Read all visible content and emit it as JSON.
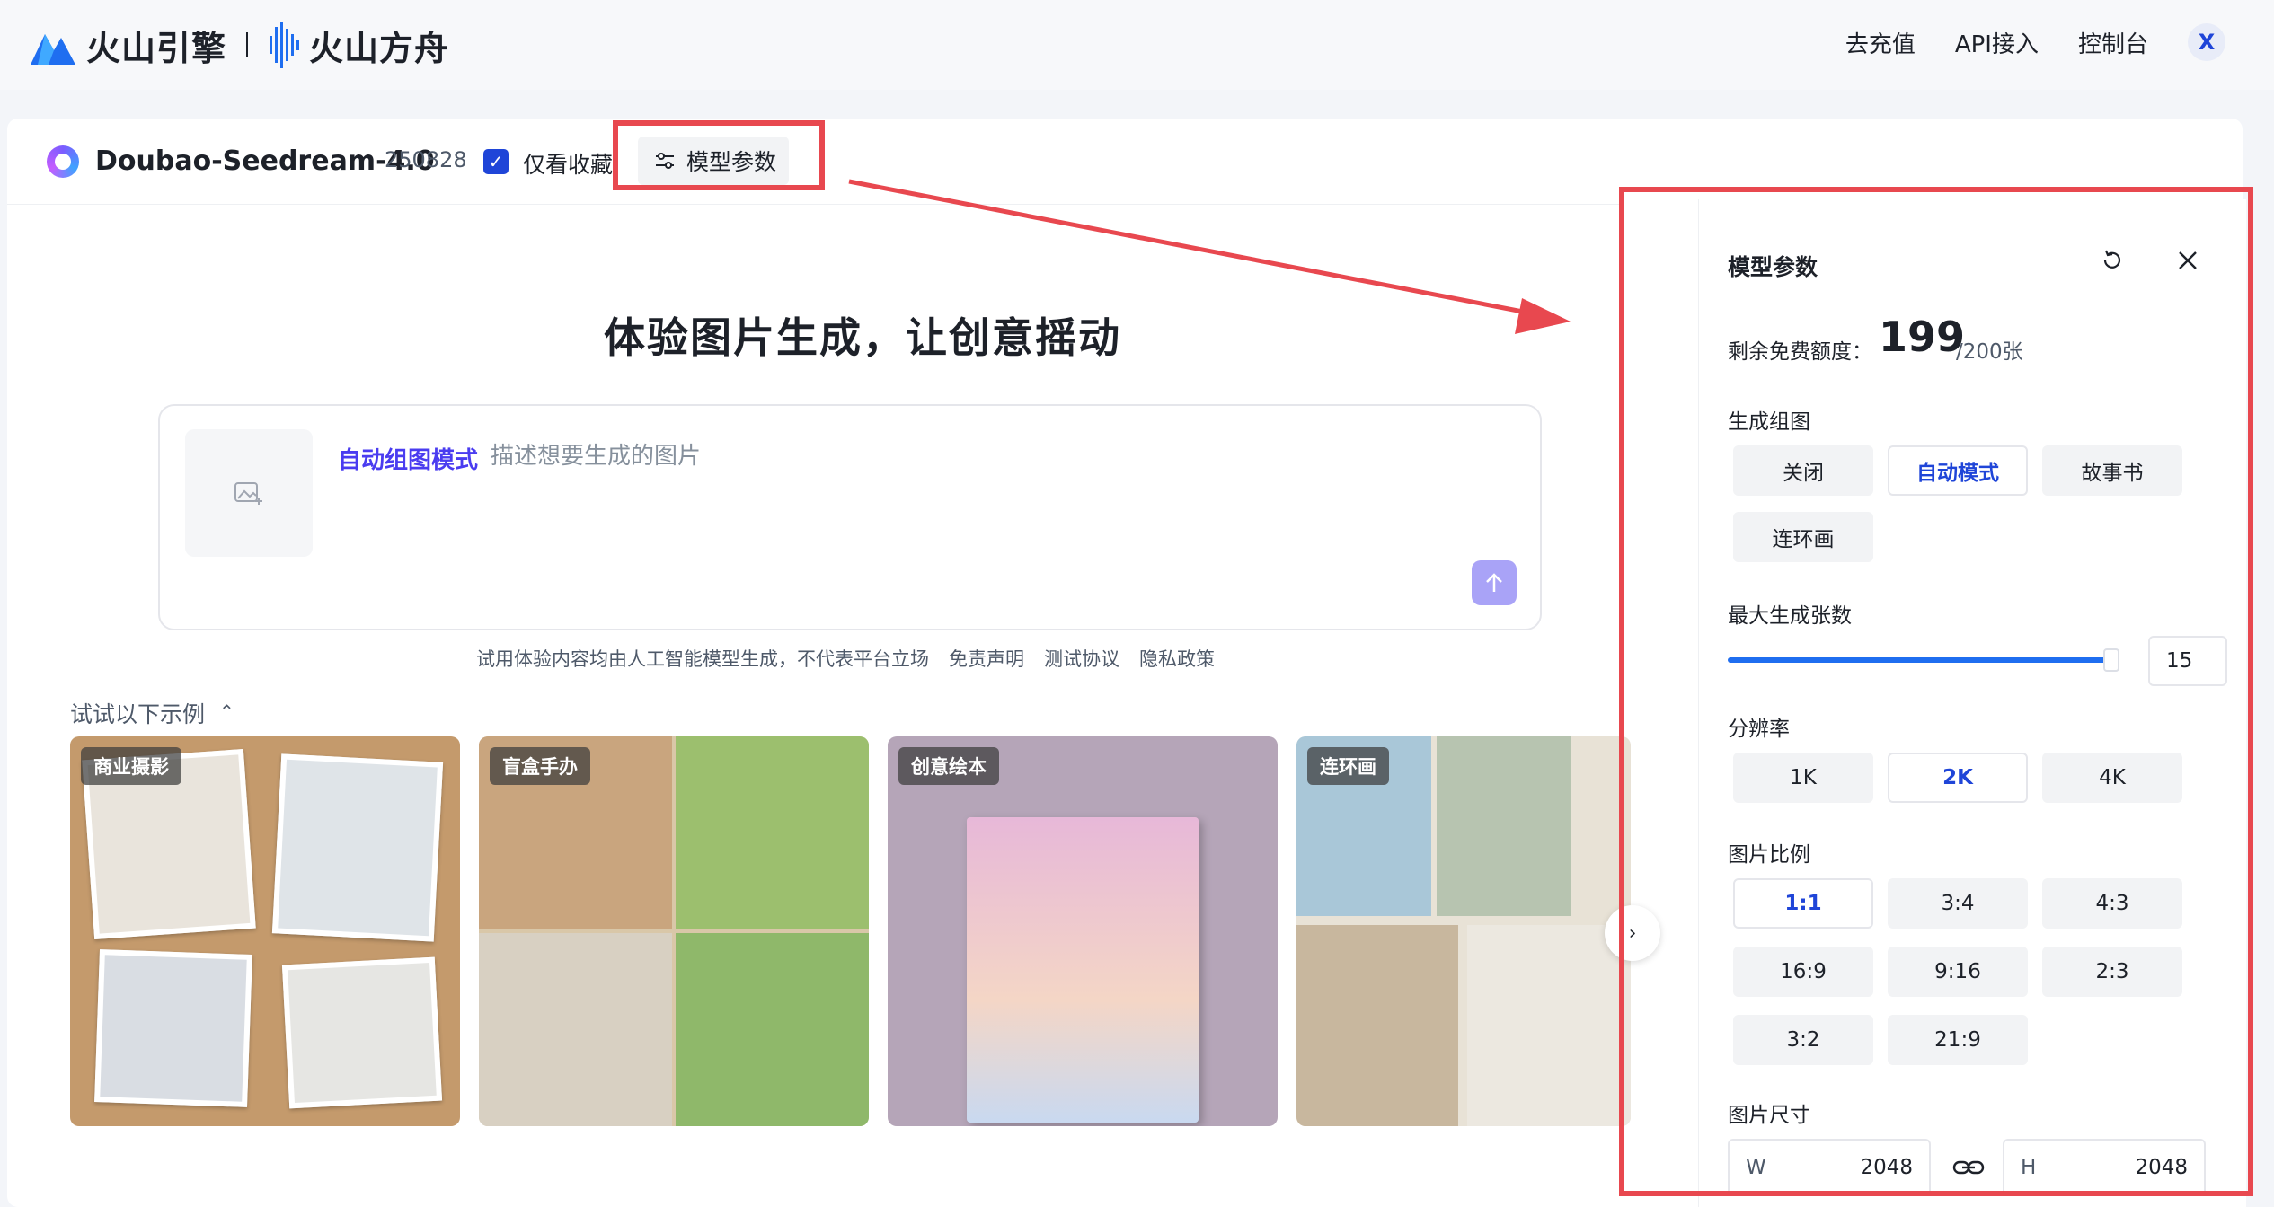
{
  "nav": {
    "brand_primary": "火山引擎",
    "brand_secondary": "火山方舟",
    "items": [
      "去充值",
      "API接入",
      "控制台"
    ],
    "avatar_letter": "X"
  },
  "header": {
    "model_name": "Doubao-Seedream-4.0",
    "model_version": "250828",
    "favorites_only_label": "仅看收藏",
    "favorites_only_checked": true,
    "params_button_label": "模型参数"
  },
  "hero": {
    "title": "体验图片生成，让创意摇动",
    "mode_tag": "自动组图模式",
    "prompt_placeholder": "描述想要生成的图片"
  },
  "disclaimer": {
    "text": "试用体验内容均由人工智能模型生成，不代表平台立场",
    "links": [
      "免责声明",
      "测试协议",
      "隐私政策"
    ]
  },
  "examples": {
    "label": "试试以下示例",
    "items": [
      {
        "tag": "商业摄影"
      },
      {
        "tag": "盲盒手办"
      },
      {
        "tag": "创意绘本"
      },
      {
        "tag": "连环画"
      }
    ]
  },
  "panel": {
    "title": "模型参数",
    "quota_label": "剩余免费额度：",
    "quota_value": "199",
    "quota_total": "/200张",
    "group_label": "生成组图",
    "group_options": [
      "关闭",
      "自动模式",
      "故事书",
      "连环画"
    ],
    "group_selected": "自动模式",
    "max_count_label": "最大生成张数",
    "max_count_value": "15",
    "max_count_fraction": 1.0,
    "resolution_label": "分辨率",
    "resolution_options": [
      "1K",
      "2K",
      "4K"
    ],
    "resolution_selected": "2K",
    "ratio_label": "图片比例",
    "ratio_options": [
      "1:1",
      "3:4",
      "4:3",
      "16:9",
      "9:16",
      "2:3",
      "3:2",
      "21:9"
    ],
    "ratio_selected": "1:1",
    "size_label": "图片尺寸",
    "width_label": "W",
    "width_value": "2048",
    "height_label": "H",
    "height_value": "2048"
  },
  "colors": {
    "accent": "#1f45d8",
    "mode_tag": "#4a3cf0",
    "highlight": "#e8484f",
    "send_button": "#a9a3f7"
  }
}
